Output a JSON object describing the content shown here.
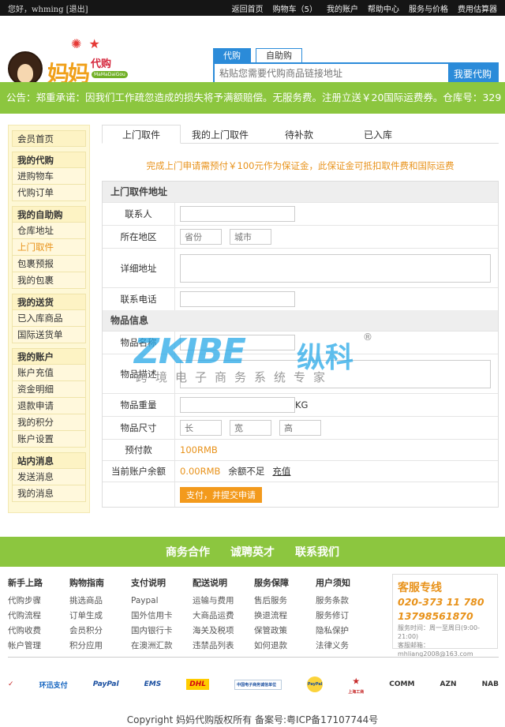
{
  "topbar": {
    "greeting": "您好，whming [退出]",
    "links": [
      "返回首页",
      "购物车（5）",
      "我的账户",
      "帮助中心",
      "服务与价格",
      "费用估算器"
    ]
  },
  "logo": {
    "brand": "妈妈",
    "brand2": "代购",
    "sub": "MaMaDaiGou"
  },
  "search": {
    "tabs": [
      "代购",
      "自助购"
    ],
    "placeholder": "粘贴您需要代购商品链接地址",
    "button": "我要代购"
  },
  "notice": "公告：郑重承诺：因我们工作疏忽造成的损失将予满额赔偿。无服务费。注册立送￥20国际运费券。仓库号：329",
  "sidebar": {
    "home": "会员首页",
    "groups": [
      {
        "title": "我的代购",
        "items": [
          "进购物车",
          "代购订单"
        ]
      },
      {
        "title": "我的自助购",
        "items": [
          "仓库地址",
          "上门取件",
          "包裹预报",
          "我的包裹"
        ]
      },
      {
        "title": "我的送货",
        "items": [
          "已入库商品",
          "国际送货单"
        ]
      },
      {
        "title": "我的账户",
        "items": [
          "账户充值",
          "资金明细",
          "退款申请",
          "我的积分",
          "账户设置"
        ]
      },
      {
        "title": "站内消息",
        "items": [
          "发送消息",
          "我的消息"
        ]
      }
    ]
  },
  "main": {
    "tabs": [
      "上门取件",
      "我的上门取件",
      "待补款",
      "已入库"
    ],
    "warning": "完成上门申请需预付￥100元作为保证金，此保证金可抵扣取件费和国际运费",
    "section1": "上门取件地址",
    "contact_label": "联系人",
    "region_label": "所在地区",
    "province_ph": "省份",
    "city_ph": "城市",
    "address_label": "详细地址",
    "phone_label": "联系电话",
    "section2": "物品信息",
    "item_name_label": "物品名称",
    "item_desc_label": "物品描述",
    "weight_label": "物品重量",
    "weight_unit": "KG",
    "size_label": "物品尺寸",
    "len_ph": "长",
    "wid_ph": "宽",
    "hei_ph": "高",
    "prepay_label": "预付款",
    "prepay_value": "100RMB",
    "balance_label": "当前账户余额",
    "balance_value": "0.00RMB",
    "insufficient": "余额不足",
    "recharge": "充值",
    "submit": "支付，并提交申请"
  },
  "watermark": {
    "big": "ZKIBE",
    "cn": "纵科",
    "sub": "跨境电子商务系统专家",
    "reg": "®"
  },
  "footer": {
    "band": [
      "商务合作",
      "诚聘英才",
      "联系我们"
    ],
    "cols": [
      {
        "title": "新手上路",
        "items": [
          "代购步骤",
          "代购流程",
          "代购收费",
          "帐户管理"
        ]
      },
      {
        "title": "购物指南",
        "items": [
          "挑选商品",
          "订单生成",
          "会员积分",
          "积分应用"
        ]
      },
      {
        "title": "支付说明",
        "items": [
          "Paypal",
          "国外信用卡",
          "国内银行卡",
          "在澳洲汇款"
        ]
      },
      {
        "title": "配送说明",
        "items": [
          "运输与费用",
          "大商品运费",
          "海关及税项",
          "违禁品列表"
        ]
      },
      {
        "title": "服务保障",
        "items": [
          "售后服务",
          "换退流程",
          "保管政策",
          "如何退款"
        ]
      },
      {
        "title": "用户须知",
        "items": [
          "服务条款",
          "服务修订",
          "隐私保护",
          "法律义务"
        ]
      }
    ],
    "service": {
      "title": "客服专线",
      "phone1": "020-373 11 780",
      "phone2": "13798561870",
      "hours": "服务时间：周一至周日(9:00-21:00)",
      "email": "客服邮箱：mhliang2008@163.com"
    },
    "logos": [
      "✓",
      "环迅支付",
      "PayPal",
      "EMS",
      "DHL",
      "中国电子商务诚信单位",
      "PayPal",
      "上海工商",
      "COMM",
      "AZN",
      "NAB"
    ],
    "copyright": "Copyright 妈妈代购版权所有 备案号:粤ICP备17107744号"
  }
}
